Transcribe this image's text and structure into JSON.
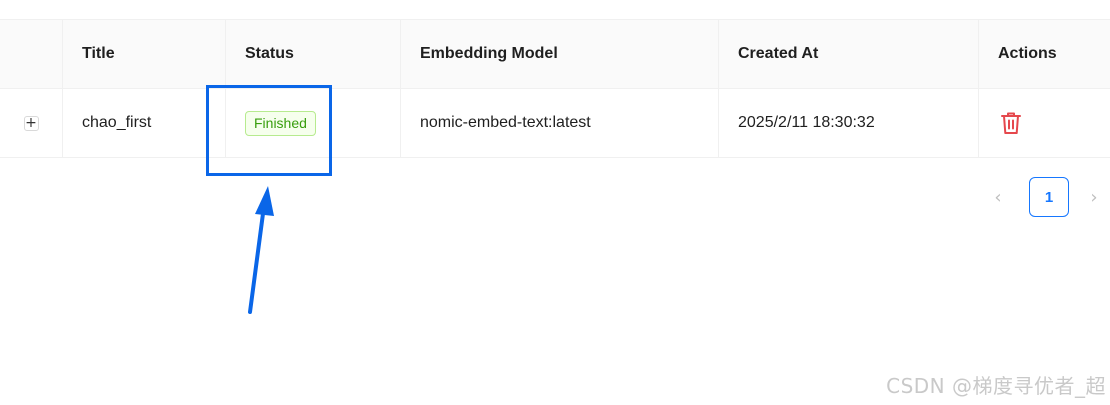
{
  "table": {
    "columns": [
      {
        "key": "expand",
        "label": ""
      },
      {
        "key": "title",
        "label": "Title"
      },
      {
        "key": "status",
        "label": "Status"
      },
      {
        "key": "model",
        "label": "Embedding Model"
      },
      {
        "key": "created",
        "label": "Created At"
      },
      {
        "key": "actions",
        "label": "Actions"
      }
    ],
    "rows": [
      {
        "expand_symbol": "+",
        "title": "chao_first",
        "status": "Finished",
        "model": "nomic-embed-text:latest",
        "created": "2025/2/11 18:30:32",
        "action_icon": "trash-icon"
      }
    ]
  },
  "pagination": {
    "prev_symbol": "‹",
    "current_page": "1",
    "next_symbol": "›"
  },
  "annotation": {
    "color": "#0a66e8"
  },
  "colors": {
    "status_green": "#389e0d",
    "delete_red": "#e5484d",
    "accent_blue": "#1677ff"
  },
  "watermark": {
    "text": "CSDN @梯度寻优者_超"
  }
}
